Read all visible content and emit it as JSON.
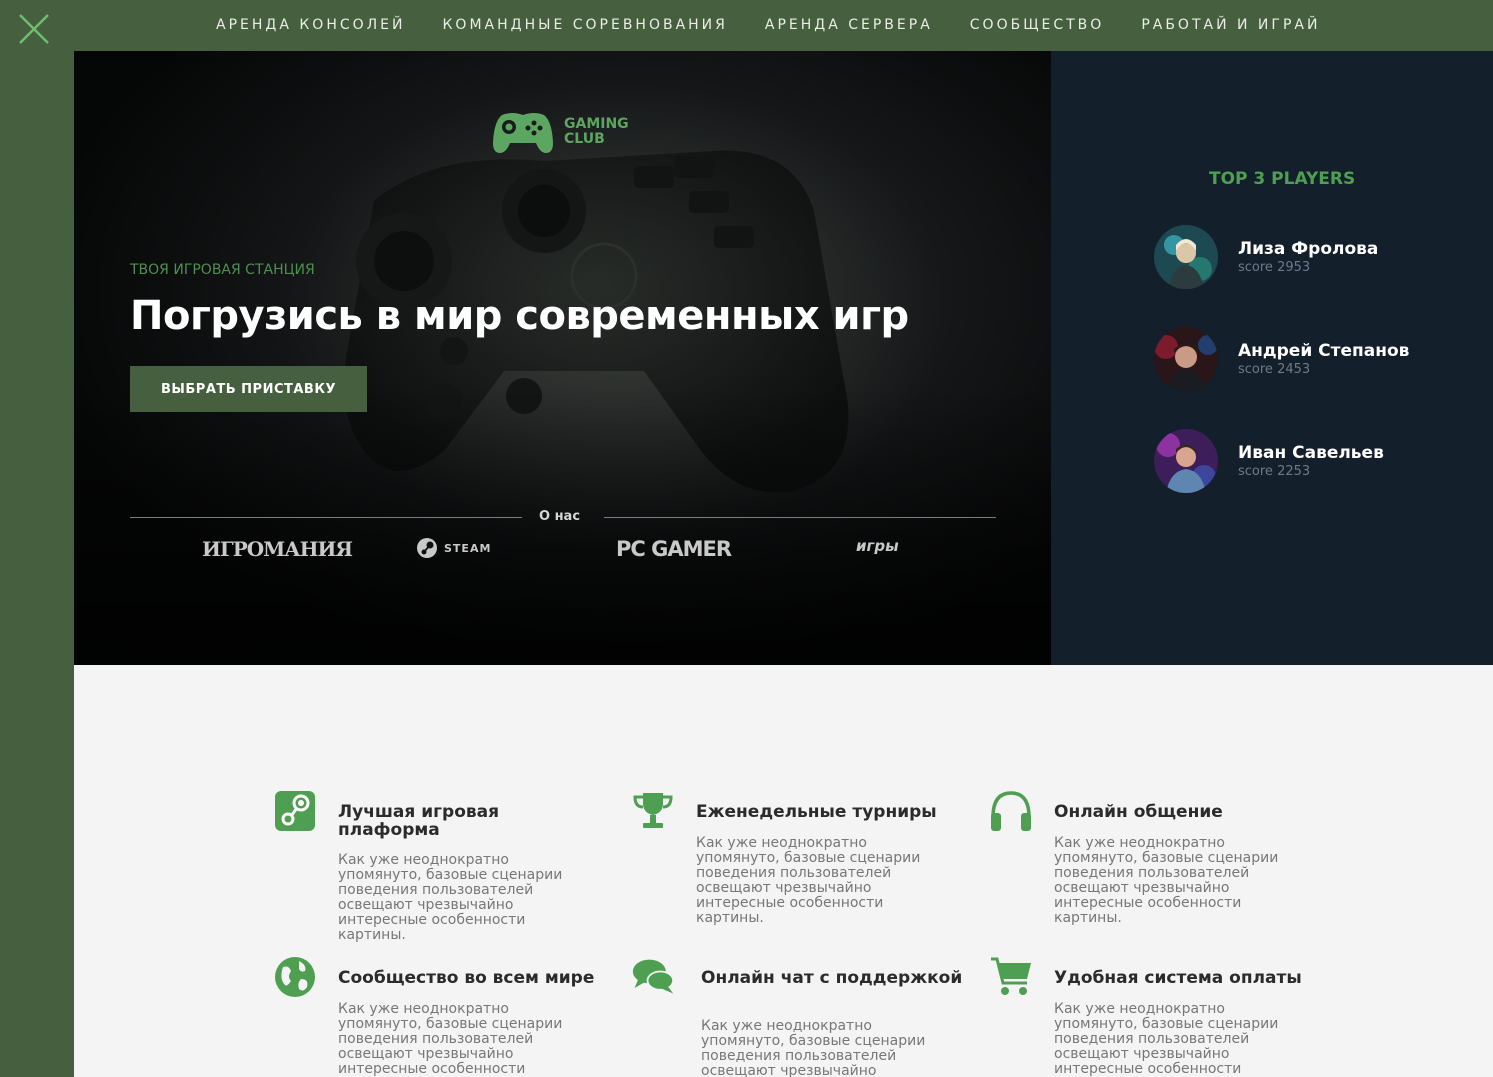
{
  "nav": {
    "items": [
      "АРЕНДА КОНСОЛЕЙ",
      "КОМАНДНЫЕ СОРЕВНОВАНИЯ",
      "АРЕНДА СЕРВЕРА",
      "СООБЩЕСТВО",
      "РАБОТАЙ И ИГРАЙ"
    ]
  },
  "logo": {
    "line1": "GAMING",
    "line2": "CLUB"
  },
  "hero": {
    "eyebrow": "ТВОЯ ИГРОВАЯ СТАНЦИЯ",
    "title": "Погрузись в мир современных игр",
    "cta": "ВЫБРАТЬ ПРИСТАВКУ",
    "about": "О нас"
  },
  "partners": [
    "ИГРОМАНИЯ",
    "STEAM",
    "PC GAMER",
    "игры"
  ],
  "top_players": {
    "title": "TOP 3 PLAYERS",
    "players": [
      {
        "name": "Лиза Фролова",
        "score": "score 2953"
      },
      {
        "name": "Андрей Степанов",
        "score": "score 2453"
      },
      {
        "name": "Иван Савельев",
        "score": "score 2253"
      }
    ]
  },
  "features": [
    {
      "title": "Лучшая игровая плаформа",
      "icon": "steam-icon",
      "desc": "Как уже неоднократно упомянуто, базовые сценарии поведения пользователей освещают чрезвычайно интересные особенности картины."
    },
    {
      "title": "Еженедельные турниры",
      "icon": "trophy-icon",
      "desc": "Как уже неоднократно упомянуто, базовые сценарии поведения пользователей освещают чрезвычайно интересные особенности картины."
    },
    {
      "title": "Онлайн общение",
      "icon": "headphones-icon",
      "desc": "Как уже неоднократно упомянуто, базовые сценарии поведения пользователей освещают чрезвычайно интересные особенности картины."
    },
    {
      "title": "Сообщество во всем мире",
      "icon": "globe-icon",
      "desc": "Как уже неоднократно упомянуто, базовые сценарии поведения пользователей освещают чрезвычайно интересные особенности"
    },
    {
      "title": "Онлайн чат с поддержкой",
      "icon": "chat-icon",
      "desc": "Как уже неоднократно упомянуто, базовые сценарии поведения пользователей освещают чрезвычайно"
    },
    {
      "title": "Удобная система оплаты",
      "icon": "cart-icon",
      "desc": "Как уже неоднократно упомянуто, базовые сценарии поведения пользователей освещают чрезвычайно интересные особенности"
    }
  ],
  "colors": {
    "brand_green": "#46603f",
    "accent_green": "#4e9f52",
    "sidebar_bg": "#141f2c"
  }
}
